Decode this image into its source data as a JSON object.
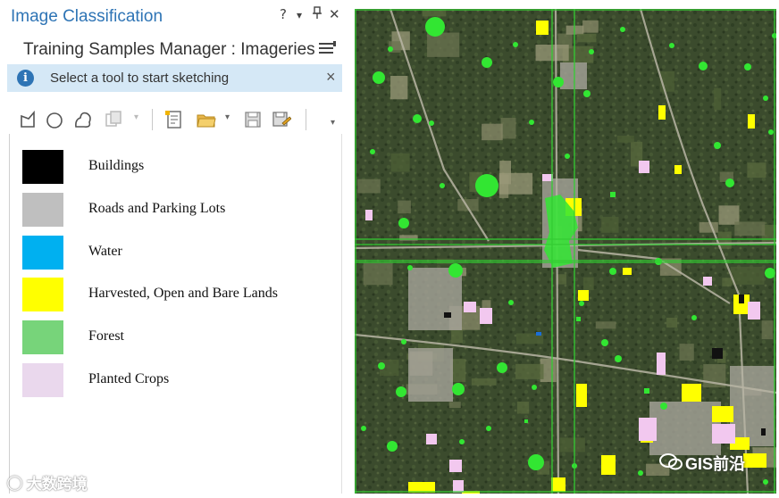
{
  "window": {
    "title": "Image Classification",
    "controls": {
      "help": "?",
      "dropdown": "▾",
      "pin": "&#x1F4CC;",
      "close": "✕"
    }
  },
  "pane": {
    "subtitle": "Training Samples Manager : Imageries",
    "menu_icon": "hamburger-menu-icon"
  },
  "info_bar": {
    "text": "Select a tool to start sketching",
    "icon": "info-icon",
    "close": "×"
  },
  "toolbar": {
    "tools": [
      {
        "name": "polygon-tool-icon"
      },
      {
        "name": "circle-tool-icon"
      },
      {
        "name": "freehand-tool-icon"
      },
      {
        "name": "select-segment-icon"
      },
      {
        "name": "create-schema-icon"
      },
      {
        "name": "open-folder-icon"
      },
      {
        "name": "save-icon"
      },
      {
        "name": "save-as-icon"
      },
      {
        "name": "overflow-icon"
      }
    ]
  },
  "classes": [
    {
      "label": "Buildings",
      "color": "#000000"
    },
    {
      "label": "Roads and Parking Lots",
      "color": "#bfbfbf"
    },
    {
      "label": "Water",
      "color": "#00b0f0"
    },
    {
      "label": "Harvested, Open and Bare Lands",
      "color": "#ffff00"
    },
    {
      "label": "Forest",
      "color": "#77d47a"
    },
    {
      "label": "Planted Crops",
      "color": "#ead8ed"
    }
  ],
  "watermarks": {
    "left": "大数跨境",
    "right": "GIS前沿"
  },
  "imagery": {
    "grid_color": "#33cc33",
    "sample_color": "#32e632",
    "open_land_color": "#ffff00",
    "crop_color": "#f2c8ef",
    "background": "#3a4a2c"
  }
}
